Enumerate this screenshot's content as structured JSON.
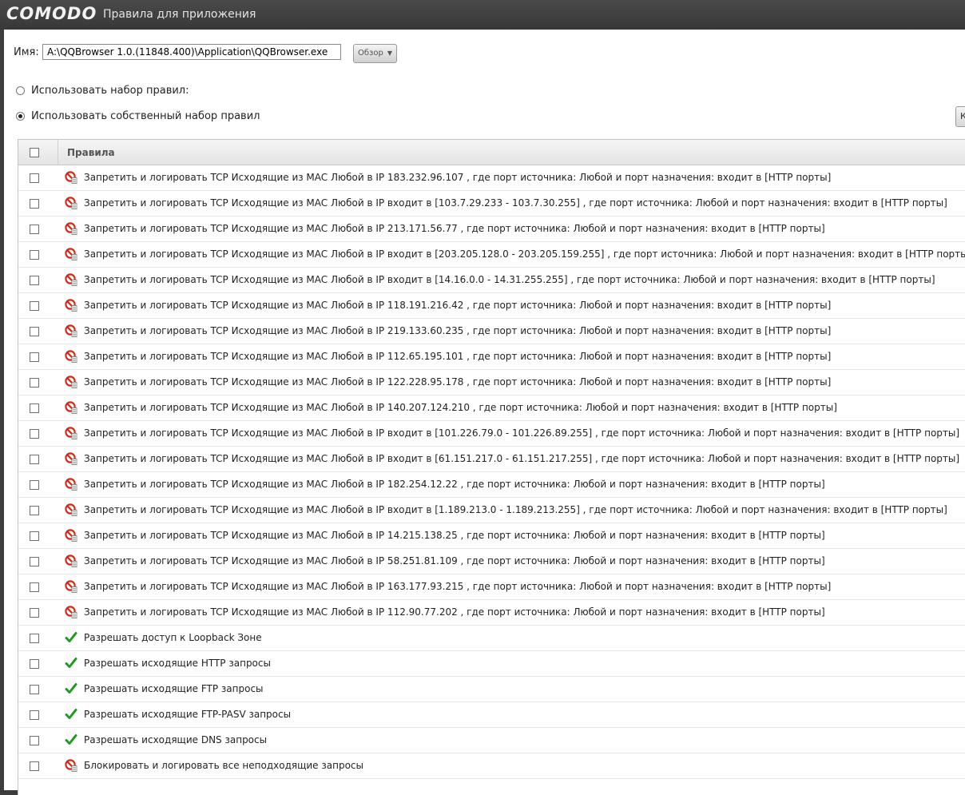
{
  "window": {
    "logo": "COMODO",
    "title": "Правила для приложения"
  },
  "form": {
    "name_label": "Имя:",
    "path_value": "A:\\QQBrowser 1.0.(11848.400)\\Application\\QQBrowser.exe",
    "browse_label": "Обзор",
    "radio_ruleset_label": "Использовать набор правил:",
    "radio_custom_label": "Использовать собственный набор правил",
    "edge_button_label": "К"
  },
  "table": {
    "header": "Правила",
    "rows": [
      {
        "icon": "block-log-icon",
        "text": "Запретить и логировать TCP Исходящие из MAC Любой в IP 183.232.96.107 , где порт источника: Любой и порт назначения: входит в [HTTP порты]"
      },
      {
        "icon": "block-log-icon",
        "text": "Запретить и логировать TCP Исходящие из MAC Любой в IP входит в [103.7.29.233 - 103.7.30.255] , где порт источника: Любой и порт назначения: входит в [HTTP порты]"
      },
      {
        "icon": "block-log-icon",
        "text": "Запретить и логировать TCP Исходящие из MAC Любой в IP 213.171.56.77 , где порт источника: Любой и порт назначения: входит в [HTTP порты]"
      },
      {
        "icon": "block-log-icon",
        "text": "Запретить и логировать TCP Исходящие из MAC Любой в IP входит в [203.205.128.0 - 203.205.159.255] , где порт источника: Любой и порт назначения: входит в [HTTP порты]"
      },
      {
        "icon": "block-log-icon",
        "text": "Запретить и логировать TCP Исходящие из MAC Любой в IP входит в [14.16.0.0 - 14.31.255.255] , где порт источника: Любой и порт назначения: входит в [HTTP порты]"
      },
      {
        "icon": "block-log-icon",
        "text": "Запретить и логировать TCP Исходящие из MAC Любой в IP 118.191.216.42 , где порт источника: Любой и порт назначения: входит в [HTTP порты]"
      },
      {
        "icon": "block-log-icon",
        "text": "Запретить и логировать TCP Исходящие из MAC Любой в IP 219.133.60.235 , где порт источника: Любой и порт назначения: входит в [HTTP порты]"
      },
      {
        "icon": "block-log-icon",
        "text": "Запретить и логировать TCP Исходящие из MAC Любой в IP 112.65.195.101 , где порт источника: Любой и порт назначения: входит в [HTTP порты]"
      },
      {
        "icon": "block-log-icon",
        "text": "Запретить и логировать TCP Исходящие из MAC Любой в IP 122.228.95.178 , где порт источника: Любой и порт назначения: входит в [HTTP порты]"
      },
      {
        "icon": "block-log-icon",
        "text": "Запретить и логировать TCP Исходящие из MAC Любой в IP 140.207.124.210 , где порт источника: Любой и порт назначения: входит в [HTTP порты]"
      },
      {
        "icon": "block-log-icon",
        "text": "Запретить и логировать TCP Исходящие из MAC Любой в IP входит в [101.226.79.0 - 101.226.89.255] , где порт источника: Любой и порт назначения: входит в [HTTP порты]"
      },
      {
        "icon": "block-log-icon",
        "text": "Запретить и логировать TCP Исходящие из MAC Любой в IP входит в [61.151.217.0 - 61.151.217.255] , где порт источника: Любой и порт назначения: входит в [HTTP порты]"
      },
      {
        "icon": "block-log-icon",
        "text": "Запретить и логировать TCP Исходящие из MAC Любой в IP 182.254.12.22 , где порт источника: Любой и порт назначения: входит в [HTTP порты]"
      },
      {
        "icon": "block-log-icon",
        "text": "Запретить и логировать TCP Исходящие из MAC Любой в IP входит в [1.189.213.0 - 1.189.213.255] , где порт источника: Любой и порт назначения: входит в [HTTP порты]"
      },
      {
        "icon": "block-log-icon",
        "text": "Запретить и логировать TCP Исходящие из MAC Любой в IP 14.215.138.25 , где порт источника: Любой и порт назначения: входит в [HTTP порты]"
      },
      {
        "icon": "block-log-icon",
        "text": "Запретить и логировать TCP Исходящие из MAC Любой в IP 58.251.81.109 , где порт источника: Любой и порт назначения: входит в [HTTP порты]"
      },
      {
        "icon": "block-log-icon",
        "text": "Запретить и логировать TCP Исходящие из MAC Любой в IP 163.177.93.215 , где порт источника: Любой и порт назначения: входит в [HTTP порты]"
      },
      {
        "icon": "block-log-icon",
        "text": "Запретить и логировать TCP Исходящие из MAC Любой в IP 112.90.77.202 , где порт источника: Любой и порт назначения: входит в [HTTP порты]"
      },
      {
        "icon": "allow-check-icon",
        "text": "Разрешать доступ к Loopback Зоне"
      },
      {
        "icon": "allow-check-icon",
        "text": "Разрешать исходящие HTTP запросы"
      },
      {
        "icon": "allow-check-icon",
        "text": "Разрешать исходящие FTP запросы"
      },
      {
        "icon": "allow-check-icon",
        "text": "Разрешать исходящие FTP-PASV запросы"
      },
      {
        "icon": "allow-check-icon",
        "text": "Разрешать исходящие DNS запросы"
      },
      {
        "icon": "block-log-icon",
        "text": "Блокировать и логировать все неподходящие запросы"
      }
    ]
  },
  "colors": {
    "block_red": "#d42a1f",
    "allow_green": "#1e9a1e",
    "titlebar": "#3d3d3d"
  }
}
